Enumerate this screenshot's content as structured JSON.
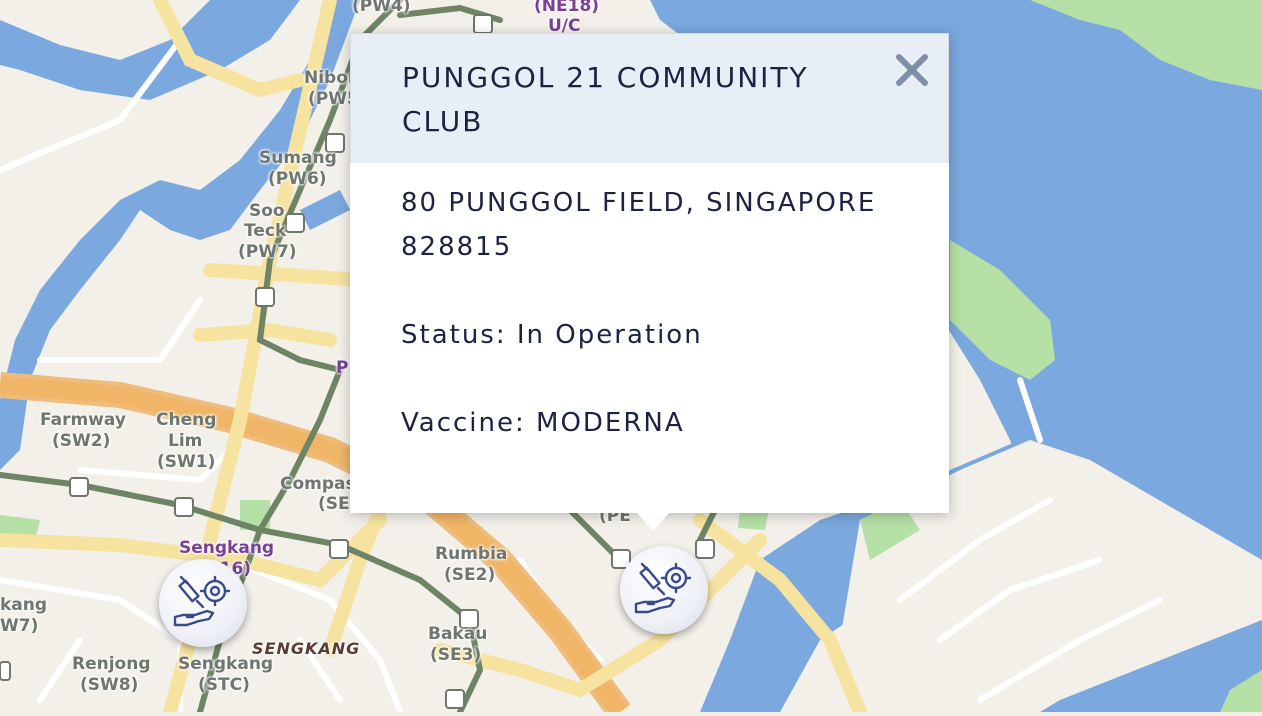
{
  "map": {
    "colors": {
      "land": "#f3f0ea",
      "water": "#7aa8df",
      "park": "#b5e0a6",
      "expressway": "#f0b567",
      "major_road": "#f6e3a0",
      "rail": "#6d8465"
    },
    "labels": [
      {
        "id": "pw4",
        "text": "(PW4)",
        "style": "gray"
      },
      {
        "id": "ne18",
        "text": "(NE18)",
        "style": "purple"
      },
      {
        "id": "uc",
        "text": "U/C",
        "style": "purple"
      },
      {
        "id": "nibong",
        "text": "Nibon",
        "style": "gray"
      },
      {
        "id": "pw5",
        "text": "(PW5",
        "style": "gray"
      },
      {
        "id": "sumang",
        "text": "Sumang",
        "style": "gray"
      },
      {
        "id": "pw6",
        "text": "(PW6)",
        "style": "gray"
      },
      {
        "id": "sooteck1",
        "text": "Soo",
        "style": "gray"
      },
      {
        "id": "sooteck2",
        "text": "Teck",
        "style": "gray"
      },
      {
        "id": "pw7",
        "text": "(PW7)",
        "style": "gray"
      },
      {
        "id": "p-frag",
        "text": "P",
        "style": "purple"
      },
      {
        "id": "farmway",
        "text": "Farmway",
        "style": "gray"
      },
      {
        "id": "sw2",
        "text": "(SW2)",
        "style": "gray"
      },
      {
        "id": "cheng",
        "text": "Cheng",
        "style": "gray"
      },
      {
        "id": "lim",
        "text": "Lim",
        "style": "gray"
      },
      {
        "id": "sw1",
        "text": "(SW1)",
        "style": "gray"
      },
      {
        "id": "compass",
        "text": "Compas",
        "style": "gray"
      },
      {
        "id": "se-frag",
        "text": "(SE",
        "style": "gray"
      },
      {
        "id": "pe-frag",
        "text": "(PE",
        "style": "gray"
      },
      {
        "id": "sengkang-purple",
        "text": "Sengkang",
        "style": "purple"
      },
      {
        "id": "ne16",
        "text": "(NE16)",
        "style": "purple"
      },
      {
        "id": "rumbia",
        "text": "Rumbia",
        "style": "gray"
      },
      {
        "id": "se2",
        "text": "(SE2)",
        "style": "gray"
      },
      {
        "id": "kangkar-frag",
        "text": "kang",
        "style": "gray"
      },
      {
        "id": "w7-frag",
        "text": "W7)",
        "style": "gray"
      },
      {
        "id": "sengkang-area",
        "text": "SENGKANG",
        "style": "area"
      },
      {
        "id": "bakau",
        "text": "Bakau",
        "style": "gray"
      },
      {
        "id": "se3",
        "text": "(SE3)",
        "style": "gray"
      },
      {
        "id": "renjong",
        "text": "Renjong",
        "style": "gray"
      },
      {
        "id": "sw8",
        "text": "(SW8)",
        "style": "gray"
      },
      {
        "id": "sengkang-stc",
        "text": "Sengkang",
        "style": "gray"
      },
      {
        "id": "stc",
        "text": "(STC)",
        "style": "gray"
      }
    ],
    "markers": [
      {
        "id": "marker-sengkang",
        "icon": "vaccination-icon",
        "color": "#3a4a8c"
      },
      {
        "id": "marker-punggol21",
        "icon": "vaccination-icon",
        "color": "#3a4a8c"
      }
    ]
  },
  "popup": {
    "title": "PUNGGOL 21 COMMUNITY CLUB",
    "close_icon": "close-icon",
    "address": "80 PUNGGOL FIELD, SINGAPORE 828815",
    "status": "Status: In Operation",
    "vaccine": "Vaccine: MODERNA",
    "header_color": "#e8eef6",
    "text_color": "#1c2340",
    "close_color": "#7f8fa8"
  }
}
